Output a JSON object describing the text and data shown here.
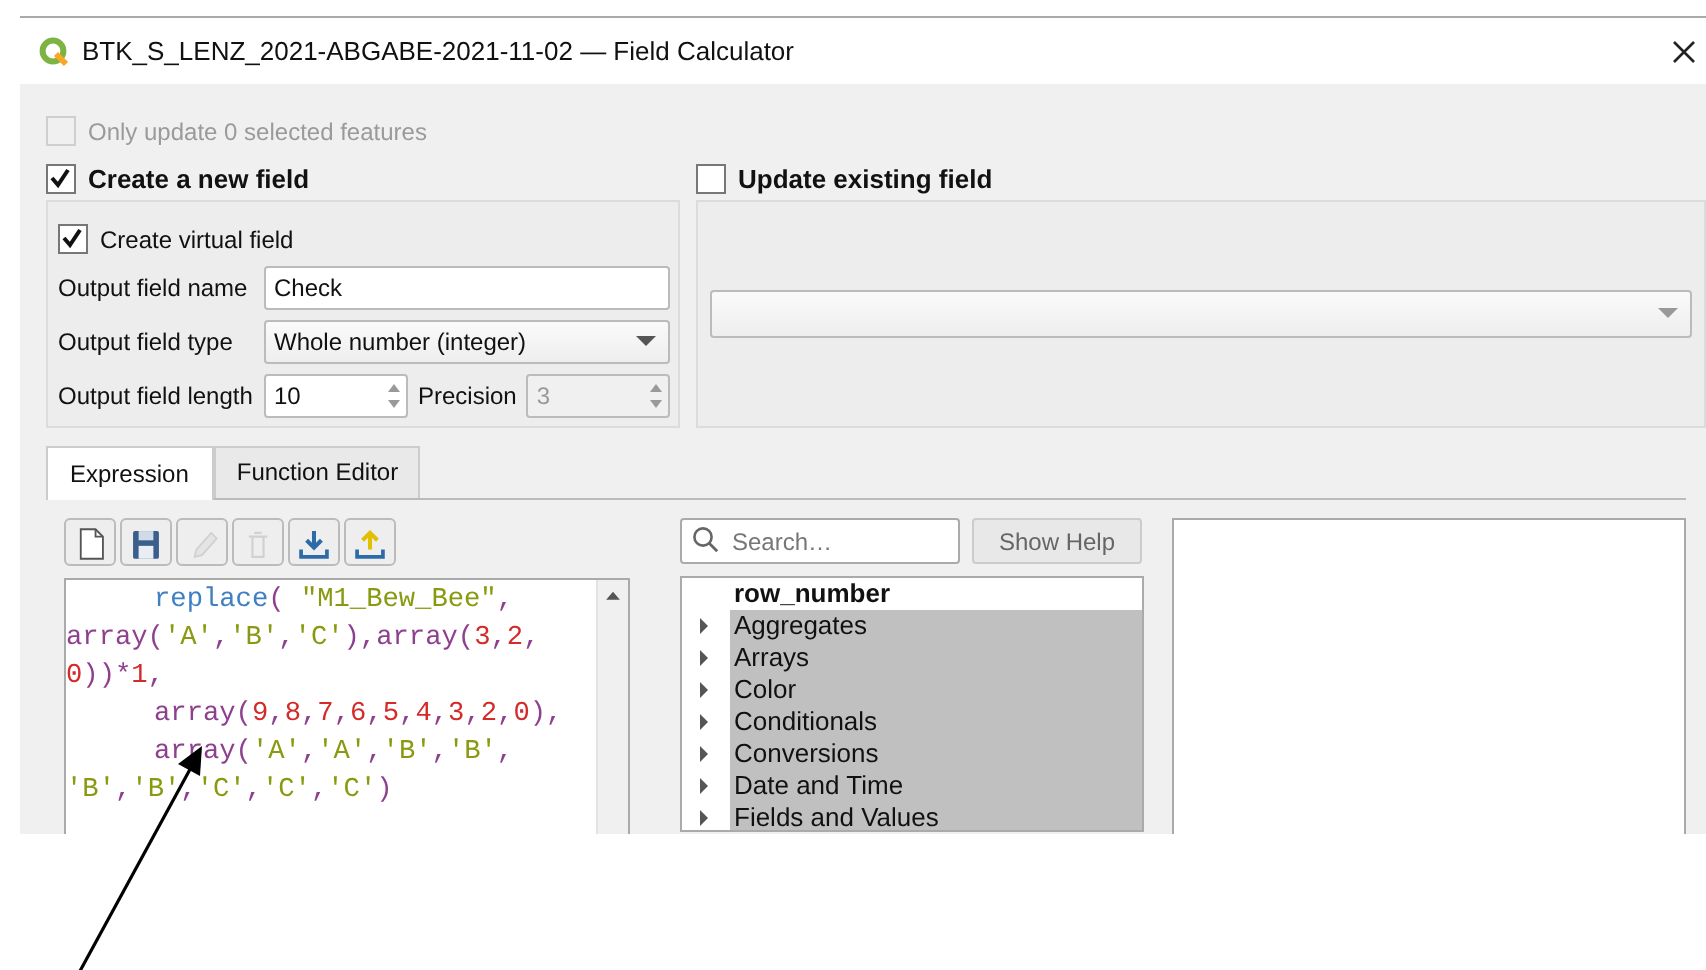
{
  "window": {
    "title": "BTK_S_LENZ_2021-ABGABE-2021-11-02 — Field Calculator"
  },
  "only_selected": {
    "label": "Only update 0 selected features",
    "checked": false,
    "disabled": true
  },
  "create_new": {
    "label": "Create a new field",
    "checked": true
  },
  "update_existing": {
    "label": "Update existing field",
    "checked": false
  },
  "virtual_field": {
    "label": "Create virtual field",
    "checked": true
  },
  "output_name": {
    "label": "Output field name",
    "value": "Check"
  },
  "output_type": {
    "label": "Output field type",
    "value": "Whole number (integer)"
  },
  "output_length": {
    "label": "Output field length",
    "value": "10"
  },
  "precision": {
    "label": "Precision",
    "value": "3",
    "disabled": true
  },
  "tabs": [
    {
      "label": "Expression",
      "selected": true
    },
    {
      "label": "Function Editor",
      "selected": false
    }
  ],
  "toolbar": [
    {
      "kind": "new",
      "disabled": false
    },
    {
      "kind": "save",
      "disabled": false
    },
    {
      "kind": "edit",
      "disabled": true
    },
    {
      "kind": "delete",
      "disabled": true
    },
    {
      "kind": "import",
      "disabled": false
    },
    {
      "kind": "export",
      "disabled": false
    }
  ],
  "expression": {
    "lines": [
      {
        "indent": true,
        "tokens": [
          {
            "kind": "function",
            "text": "replace"
          },
          {
            "kind": "punct",
            "text": "( "
          },
          {
            "kind": "field",
            "text": "\"M1_Bew_Bee\""
          },
          {
            "kind": "punct",
            "text": ","
          }
        ]
      },
      {
        "indent": false,
        "tokens": [
          {
            "kind": "keyword",
            "text": "array"
          },
          {
            "kind": "punct",
            "text": "("
          },
          {
            "kind": "string",
            "text": "'A'"
          },
          {
            "kind": "punct",
            "text": ","
          },
          {
            "kind": "string",
            "text": "'B'"
          },
          {
            "kind": "punct",
            "text": ","
          },
          {
            "kind": "string",
            "text": "'C'"
          },
          {
            "kind": "punct",
            "text": "),"
          },
          {
            "kind": "keyword",
            "text": "array"
          },
          {
            "kind": "punct",
            "text": "("
          },
          {
            "kind": "number",
            "text": "3"
          },
          {
            "kind": "punct",
            "text": ","
          },
          {
            "kind": "number",
            "text": "2"
          },
          {
            "kind": "punct",
            "text": ","
          }
        ]
      },
      {
        "indent": false,
        "tokens": [
          {
            "kind": "number",
            "text": "0"
          },
          {
            "kind": "punct",
            "text": "))*"
          },
          {
            "kind": "number",
            "text": "1"
          },
          {
            "kind": "punct",
            "text": ","
          }
        ]
      },
      {
        "indent": true,
        "tokens": [
          {
            "kind": "keyword",
            "text": "array"
          },
          {
            "kind": "punct",
            "text": "("
          },
          {
            "kind": "number",
            "text": "9"
          },
          {
            "kind": "punct",
            "text": ","
          },
          {
            "kind": "number",
            "text": "8"
          },
          {
            "kind": "punct",
            "text": ","
          },
          {
            "kind": "number",
            "text": "7"
          },
          {
            "kind": "punct",
            "text": ","
          },
          {
            "kind": "number",
            "text": "6"
          },
          {
            "kind": "punct",
            "text": ","
          },
          {
            "kind": "number",
            "text": "5"
          },
          {
            "kind": "punct",
            "text": ","
          },
          {
            "kind": "number",
            "text": "4"
          },
          {
            "kind": "punct",
            "text": ","
          },
          {
            "kind": "number",
            "text": "3"
          },
          {
            "kind": "punct",
            "text": ","
          },
          {
            "kind": "number",
            "text": "2"
          },
          {
            "kind": "punct",
            "text": ","
          },
          {
            "kind": "number",
            "text": "0"
          },
          {
            "kind": "punct",
            "text": "),"
          }
        ]
      },
      {
        "indent": true,
        "tokens": [
          {
            "kind": "keyword",
            "text": "array"
          },
          {
            "kind": "punct",
            "text": "("
          },
          {
            "kind": "string",
            "text": "'A'"
          },
          {
            "kind": "punct",
            "text": ","
          },
          {
            "kind": "string",
            "text": "'A'"
          },
          {
            "kind": "punct",
            "text": ","
          },
          {
            "kind": "string",
            "text": "'B'"
          },
          {
            "kind": "punct",
            "text": ","
          },
          {
            "kind": "string",
            "text": "'B'"
          },
          {
            "kind": "punct",
            "text": ","
          }
        ]
      },
      {
        "indent": false,
        "tokens": [
          {
            "kind": "string",
            "text": "'B'"
          },
          {
            "kind": "punct",
            "text": ","
          },
          {
            "kind": "string",
            "text": "'B'"
          },
          {
            "kind": "punct",
            "text": ","
          },
          {
            "kind": "string",
            "text": "'C'"
          },
          {
            "kind": "punct",
            "text": ","
          },
          {
            "kind": "string",
            "text": "'C'"
          },
          {
            "kind": "punct",
            "text": ","
          },
          {
            "kind": "string",
            "text": "'C'"
          },
          {
            "kind": "punct",
            "text": ")"
          }
        ]
      }
    ]
  },
  "search": {
    "placeholder": "Search…"
  },
  "show_help": {
    "label": "Show Help"
  },
  "functions": [
    {
      "kind": "item",
      "label": "row_number"
    },
    {
      "kind": "group",
      "label": "Aggregates",
      "expanded": false
    },
    {
      "kind": "group",
      "label": "Arrays",
      "expanded": false
    },
    {
      "kind": "group",
      "label": "Color",
      "expanded": false
    },
    {
      "kind": "group",
      "label": "Conditionals",
      "expanded": false
    },
    {
      "kind": "group",
      "label": "Conversions",
      "expanded": false
    },
    {
      "kind": "group",
      "label": "Date and Time",
      "expanded": false
    },
    {
      "kind": "group",
      "label": "Fields and Values",
      "expanded": false
    }
  ]
}
